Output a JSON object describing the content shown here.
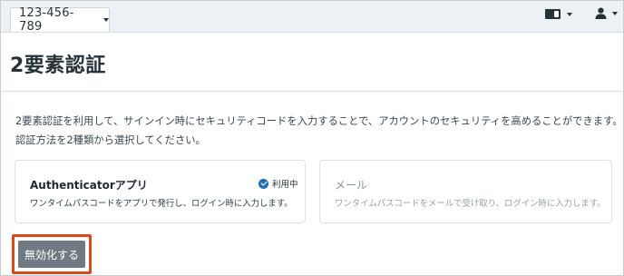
{
  "header": {
    "account_tab_label": "123-456-789",
    "icons": {
      "account_dropdown": "caret-down-icon",
      "language": "translate-icon",
      "user": "user-icon"
    }
  },
  "page": {
    "title": "2要素認証"
  },
  "description": {
    "line1": "2要素認証を利用して、サインイン時にセキュリティコードを入力することで、アカウントのセキュリティを高めることができます。",
    "line2": "認証方法を2種類から選択してください。"
  },
  "methods": [
    {
      "title": "Authenticatorアプリ",
      "description": "ワンタイムパスコードをアプリで発行し、ログイン時に入力します。",
      "badge": "利用中",
      "badge_icon": "check-circle-icon",
      "active": true
    },
    {
      "title": "メール",
      "description": "ワンタイムパスコードをメールで受け取り、ログイン時に入力します。",
      "active": false
    }
  ],
  "actions": {
    "disable_label": "無効化する"
  },
  "colors": {
    "highlight_border": "#d84a1b",
    "button_bg": "#6f7a82",
    "badge_icon": "#1f6fb2",
    "topbar_bg": "#eef1f4"
  }
}
